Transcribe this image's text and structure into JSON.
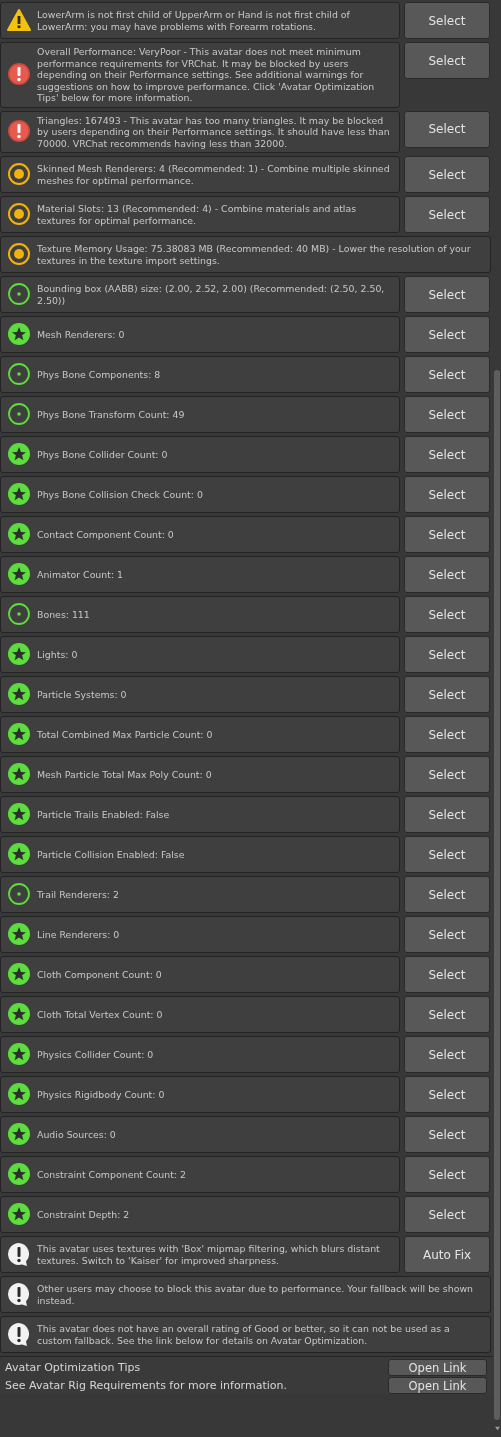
{
  "messages": [
    {
      "kind": "warning",
      "text": "LowerArm is not first child of UpperArm or Hand is not first child of LowerArm: you may have problems with Forearm rotations.",
      "button": "Select"
    },
    {
      "kind": "error",
      "text": "Overall Performance: VeryPoor - This avatar does not meet minimum performance requirements for VRChat. It may be blocked by users depending on their Performance settings. See additional warnings for suggestions on how to improve performance. Click 'Avatar Optimization Tips' below for more information.",
      "button": "Select"
    },
    {
      "kind": "error",
      "text": "Triangles: 167493 - This avatar has too many triangles. It may be blocked by users depending on their Performance settings. It should have less than 70000. VRChat recommends having less than 32000.",
      "button": "Select"
    },
    {
      "kind": "medium",
      "text": "Skinned Mesh Renderers: 4 (Recommended: 1) - Combine multiple skinned meshes for optimal performance.",
      "button": "Select"
    },
    {
      "kind": "medium",
      "text": "Material Slots: 13 (Recommended: 4) - Combine materials and atlas textures for optimal performance.",
      "button": "Select"
    },
    {
      "kind": "medium",
      "text": "Texture Memory Usage: 75.38083 MB (Recommended: 40 MB) - Lower the resolution of your textures in the texture import settings."
    },
    {
      "kind": "good",
      "text": "Bounding box (AABB) size: (2.00, 2.52, 2.00) (Recommended: (2.50, 2.50, 2.50))",
      "button": "Select"
    },
    {
      "kind": "excellent",
      "text": "Mesh Renderers: 0",
      "button": "Select"
    },
    {
      "kind": "good",
      "text": "Phys Bone Components: 8",
      "button": "Select"
    },
    {
      "kind": "good",
      "text": "Phys Bone Transform Count: 49",
      "button": "Select"
    },
    {
      "kind": "excellent",
      "text": "Phys Bone Collider Count: 0",
      "button": "Select"
    },
    {
      "kind": "excellent",
      "text": "Phys Bone Collision Check Count: 0",
      "button": "Select"
    },
    {
      "kind": "excellent",
      "text": "Contact Component Count: 0",
      "button": "Select"
    },
    {
      "kind": "excellent",
      "text": "Animator Count: 1",
      "button": "Select"
    },
    {
      "kind": "good",
      "text": "Bones: 111",
      "button": "Select"
    },
    {
      "kind": "excellent",
      "text": "Lights: 0",
      "button": "Select"
    },
    {
      "kind": "excellent",
      "text": "Particle Systems: 0",
      "button": "Select"
    },
    {
      "kind": "excellent",
      "text": "Total Combined Max Particle Count: 0",
      "button": "Select"
    },
    {
      "kind": "excellent",
      "text": "Mesh Particle Total Max Poly Count: 0",
      "button": "Select"
    },
    {
      "kind": "excellent",
      "text": "Particle Trails Enabled: False",
      "button": "Select"
    },
    {
      "kind": "excellent",
      "text": "Particle Collision Enabled: False",
      "button": "Select"
    },
    {
      "kind": "good",
      "text": "Trail Renderers: 2",
      "button": "Select"
    },
    {
      "kind": "excellent",
      "text": "Line Renderers: 0",
      "button": "Select"
    },
    {
      "kind": "excellent",
      "text": "Cloth Component Count: 0",
      "button": "Select"
    },
    {
      "kind": "excellent",
      "text": "Cloth Total Vertex Count: 0",
      "button": "Select"
    },
    {
      "kind": "excellent",
      "text": "Physics Collider Count: 0",
      "button": "Select"
    },
    {
      "kind": "excellent",
      "text": "Physics Rigidbody Count: 0",
      "button": "Select"
    },
    {
      "kind": "excellent",
      "text": "Audio Sources: 0",
      "button": "Select"
    },
    {
      "kind": "excellent",
      "text": "Constraint Component Count: 2",
      "button": "Select"
    },
    {
      "kind": "excellent",
      "text": "Constraint Depth: 2",
      "button": "Select"
    },
    {
      "kind": "info",
      "text": "This avatar uses textures with 'Box' mipmap filtering, which blurs distant textures. Switch to 'Kaiser' for improved sharpness.",
      "button": "Auto Fix"
    },
    {
      "kind": "info",
      "text": "Other users may choose to block this avatar due to performance. Your fallback will be shown instead."
    },
    {
      "kind": "info",
      "text": "This avatar does not have an overall rating of Good or better, so it can not be used as a custom fallback. See the link below for details on Avatar Optimization."
    }
  ],
  "links": [
    {
      "label": "Avatar Optimization Tips",
      "button": "Open Link"
    },
    {
      "label": "See Avatar Rig Requirements for more information.",
      "button": "Open Link"
    }
  ]
}
